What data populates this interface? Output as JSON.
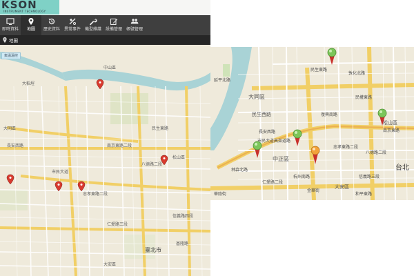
{
  "brand": {
    "logo_text": "KSON",
    "logo_sub": "INSTRUMENT TECHNOLOGY"
  },
  "toolbar": {
    "items": [
      {
        "label": "即時資料",
        "icon": "monitor-icon",
        "active": false
      },
      {
        "label": "地圖",
        "icon": "map-pin-icon",
        "active": true
      },
      {
        "label": "歷史資料",
        "icon": "history-icon",
        "active": false
      },
      {
        "label": "異常事件",
        "icon": "alert-icon",
        "active": false
      },
      {
        "label": "機型維護",
        "icon": "wrench-icon",
        "active": false
      },
      {
        "label": "設備管理",
        "icon": "edit-icon",
        "active": false
      },
      {
        "label": "帳號管理",
        "icon": "users-icon",
        "active": false
      }
    ]
  },
  "subheader": {
    "title": "地圖",
    "icon": "map-pin-icon"
  },
  "map_overview": {
    "tag": "東溫溫控",
    "labels": [
      "大稻埕",
      "中山區",
      "大同區",
      "民生東路",
      "長安西路",
      "南京東路二段",
      "市民大道",
      "忠孝東路二段",
      "八德路二段",
      "仁愛路三段",
      "臺北市",
      "大安區",
      "松山區",
      "信義路四段",
      "基隆路"
    ],
    "marker_color": "#d83a2e"
  },
  "map_zoom": {
    "labels": [
      "大同區",
      "民生西路",
      "中正區",
      "市民大道高架道路",
      "忠孝東路二段",
      "台北",
      "大安區",
      "松山區",
      "南京東路",
      "八德路二段",
      "杭州南路",
      "林森北路",
      "華陰街",
      "長安西路",
      "民權東路",
      "信義路三段",
      "延平北路",
      "民生東路",
      "和平東路",
      "復興南路",
      "敦化北路",
      "金華街",
      "仁愛路二段"
    ],
    "marker_colors": {
      "normal": "#7cc65a",
      "warning": "#f2a23a",
      "base": "#c9302c"
    }
  }
}
